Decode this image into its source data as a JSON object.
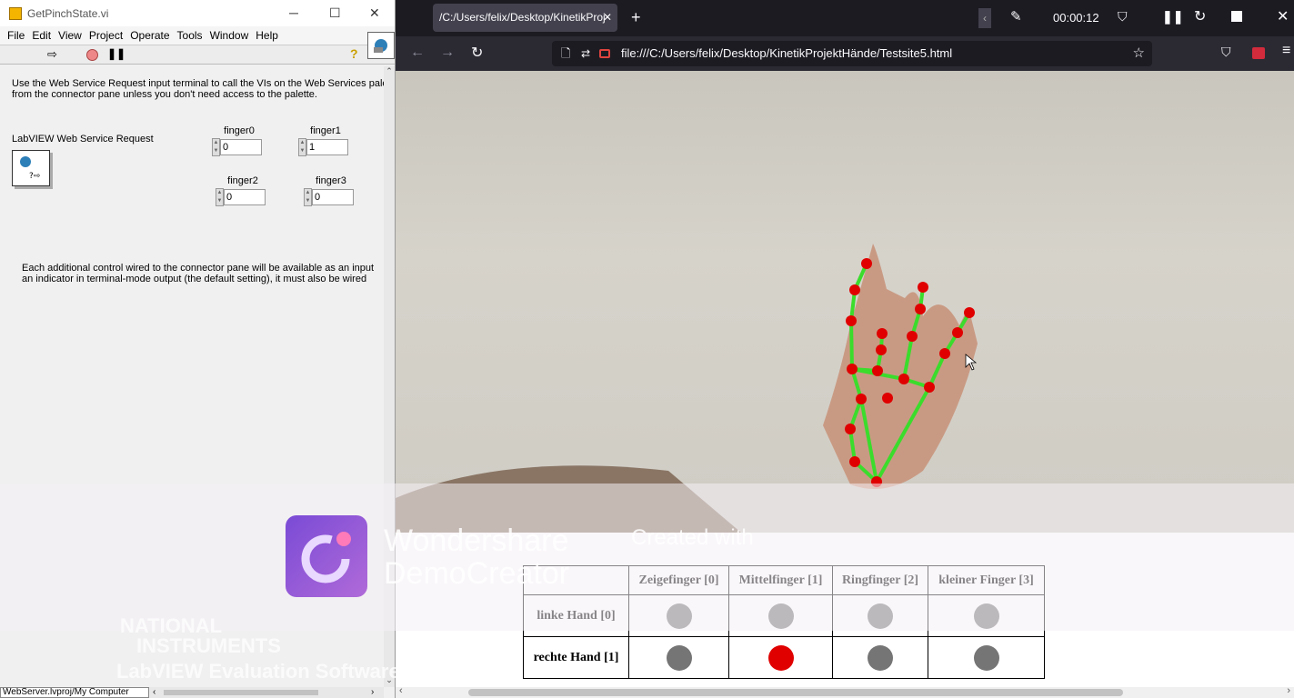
{
  "labview": {
    "window_title": "GetPinchState.vi",
    "menu": [
      "File",
      "Edit",
      "View",
      "Project",
      "Operate",
      "Tools",
      "Window",
      "Help"
    ],
    "desc1_line1": "Use the Web Service Request input terminal to call the VIs on the Web Services pale",
    "desc1_line2": "from the connector pane unless you don't need access to the palette.",
    "request_label": "LabVIEW Web Service Request",
    "fingers": [
      {
        "label": "finger0",
        "value": "0"
      },
      {
        "label": "finger1",
        "value": "1"
      },
      {
        "label": "finger2",
        "value": "0"
      },
      {
        "label": "finger3",
        "value": "0"
      }
    ],
    "desc2_line1": "Each additional control wired to the connector pane will be available as an input",
    "desc2_line2": "an indicator in terminal-mode output (the default setting), it must also be wired",
    "status_path": "WebServer.lvproj/My Computer",
    "watermark_ni_1": "NATIONAL",
    "watermark_ni_2": "INSTRUMENTS",
    "watermark_ni_3": "LabVIEW Evaluation Software"
  },
  "browser": {
    "tab_title": "/C:/Users/felix/Desktop/KinetikProj",
    "timer": "00:00:12",
    "url": "file:///C:/Users/felix/Desktop/KinetikProjektHände/Testsite5.html"
  },
  "watermark": {
    "brand_line1": "Wondershare",
    "brand_line2": "DemoCreator",
    "created_with": "Created with"
  },
  "table": {
    "headers": [
      "",
      "Zeigefinger [0]",
      "Mittelfinger [1]",
      "Ringfinger [2]",
      "kleiner Finger [3]"
    ],
    "rows": [
      {
        "label": "linke Hand [0]",
        "states": [
          false,
          false,
          false,
          false
        ]
      },
      {
        "label": "rechte Hand [1]",
        "states": [
          false,
          true,
          false,
          false
        ]
      }
    ]
  },
  "colors": {
    "active": "#e00000",
    "inactive": "#757575",
    "skeleton": "#3bdc2c",
    "joint": "#e00000"
  }
}
